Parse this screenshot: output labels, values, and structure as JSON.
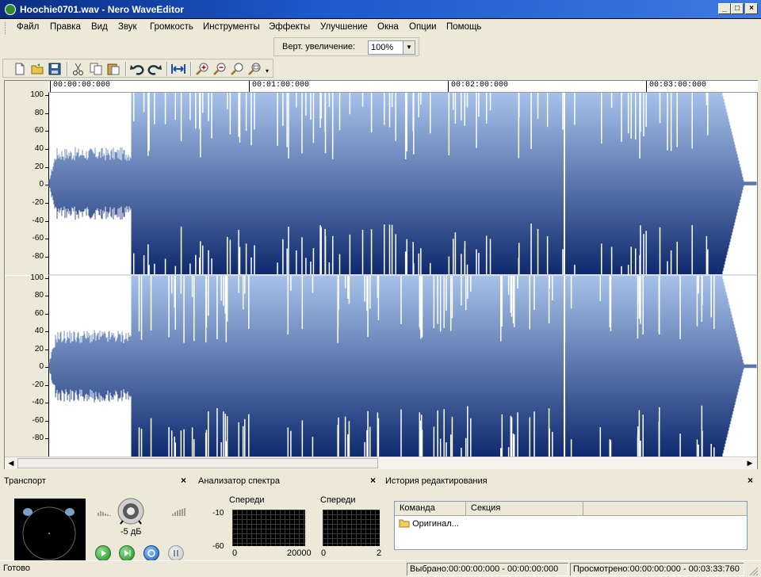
{
  "window": {
    "title": "Hoochie0701.wav - Nero WaveEditor"
  },
  "menu": [
    "Файл",
    "Правка",
    "Вид",
    "Звук",
    "Громкость",
    "Инструменты",
    "Эффекты",
    "Улучшение",
    "Окна",
    "Опции",
    "Помощь"
  ],
  "zoom": {
    "label": "Верт. увеличение:",
    "value": "100%"
  },
  "toolbar": {
    "icons": [
      "new-file-icon",
      "open-folder-icon",
      "save-icon",
      "cut-icon",
      "copy-icon",
      "paste-icon",
      "undo-icon",
      "redo-icon",
      "fit-width-icon",
      "zoom-in-icon",
      "zoom-out-icon",
      "zoom-selection-icon",
      "zoom-full-icon"
    ]
  },
  "ruler": {
    "labels": [
      "00:00:00:000",
      "00:01:00:000",
      "00:02:00:000",
      "00:03:00:000"
    ]
  },
  "yaxis": {
    "labels": [
      "100",
      "80",
      "60",
      "40",
      "20",
      "0",
      "-20",
      "-40",
      "-60",
      "-80"
    ]
  },
  "colors": {
    "wave_top": "#a6c2ea",
    "wave_bottom": "#0f2a6e"
  },
  "panels": {
    "transport": {
      "title": "Транспорт",
      "volume": "-5 дБ"
    },
    "spectrum": {
      "title": "Анализатор спектра",
      "left_label": "Спереди",
      "right_label": "Спереди",
      "y_top": "-10",
      "y_bottom": "-60",
      "x_min": "0",
      "x_max": "20000",
      "x_min_right": "0",
      "x_max_right": "2"
    },
    "history": {
      "title": "История редактирования",
      "columns": [
        "Команда",
        "Секция"
      ],
      "rows": [
        "Оригинал..."
      ]
    }
  },
  "status": {
    "ready": "Готово",
    "selected": "Выбрано:00:00:00:000 - 00:00:00:000",
    "viewed": "Просмотрено:00:00:00:000 - 00:03:33:760"
  }
}
